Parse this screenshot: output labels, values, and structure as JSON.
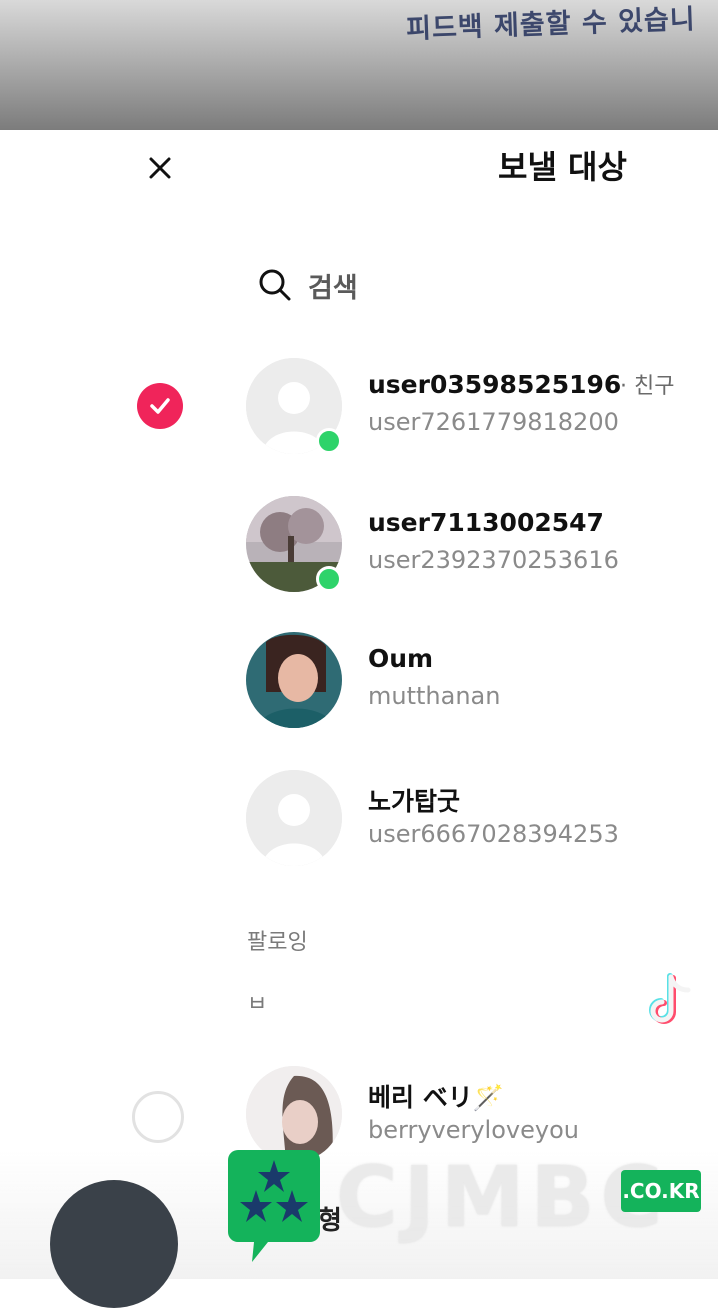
{
  "top_banner": {
    "text": "피드백 제출할 수 있습니"
  },
  "sheet": {
    "title": "보낼 대상",
    "search_placeholder": "검색"
  },
  "contacts": [
    {
      "name": "user03598525196",
      "tag": "· 친구",
      "handle": "user7261779818200",
      "selected": true,
      "online": true,
      "avatar": "default-avatar"
    },
    {
      "name": "user7113002547",
      "tag": "",
      "handle": "user2392370253616",
      "selected": false,
      "online": true,
      "avatar": "photo-tree"
    },
    {
      "name": "Oum",
      "tag": "",
      "handle": "mutthanan",
      "selected": false,
      "online": false,
      "avatar": "photo-woman"
    },
    {
      "name": "노가탑굿",
      "tag": "",
      "handle": "user6667028394253",
      "selected": false,
      "online": false,
      "avatar": "default-avatar"
    }
  ],
  "following_section": {
    "label": "팔로잉",
    "index_letter": "ㅂ",
    "contacts": [
      {
        "name": "베리 ベリ🪄",
        "handle": "berryveryloveyou",
        "selected": false,
        "avatar": "photo-berry"
      }
    ]
  },
  "partial_bottom_text": "형",
  "watermark": {
    "brand": "CJMBC",
    "badge": ".CO.KR"
  },
  "colors": {
    "accent": "#f0245a",
    "online": "#2ed36a",
    "watermark_green": "#14b35b"
  }
}
